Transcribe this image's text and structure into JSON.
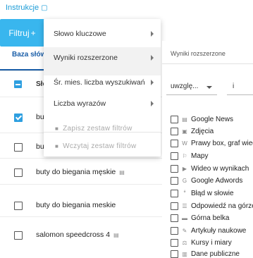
{
  "header": {
    "instructions": "Instrukcje",
    "filter_button": "Filtruj",
    "filter_plus": "+"
  },
  "tabs": [
    {
      "label": "Baza słów kl"
    }
  ],
  "table": {
    "column": "Słow",
    "rows": [
      {
        "keyword": "buty",
        "checked": true,
        "doc_icon": false
      },
      {
        "keyword": "buty",
        "checked": false,
        "doc_icon": false
      },
      {
        "keyword": "buty do biegania męskie",
        "checked": false,
        "doc_icon": true
      },
      {
        "keyword": "buty do biegania meskie",
        "checked": false,
        "doc_icon": false
      },
      {
        "keyword": "salomon speedcross 4",
        "checked": false,
        "doc_icon": true
      }
    ]
  },
  "menu": {
    "items": [
      {
        "label": "Słowo kluczowe",
        "submenu": true
      },
      {
        "label": "Wyniki rozszerzone",
        "submenu": true,
        "highlighted": true
      },
      {
        "label": "Śr. mies. liczba wyszukiwań",
        "submenu": true
      },
      {
        "label": "Liczba wyrazów",
        "submenu": true
      }
    ],
    "disabled_items": [
      {
        "label": "Zapisz zestaw filtrów",
        "icon": "floppy-icon"
      },
      {
        "label": "Wczytaj zestaw filtrów",
        "icon": "floppy-icon"
      }
    ]
  },
  "panel": {
    "title": "Wyniki rozszerzone",
    "select_value": "uwzglę...",
    "input_value": "i",
    "features": [
      {
        "label": "Google News",
        "icon": "news-icon",
        "glyph": "▤"
      },
      {
        "label": "Zdjęcia",
        "icon": "image-icon",
        "glyph": "▣"
      },
      {
        "label": "Prawy box, graf wiedzy",
        "icon": "box-icon",
        "glyph": "W"
      },
      {
        "label": "Mapy",
        "icon": "map-icon",
        "glyph": "⚐"
      },
      {
        "label": "Wideo w wynikach",
        "icon": "video-icon",
        "glyph": "▶"
      },
      {
        "label": "Google Adwords",
        "icon": "google-icon",
        "glyph": "G"
      },
      {
        "label": "Błąd w słowie",
        "icon": "typo-icon",
        "glyph": "ꜜ"
      },
      {
        "label": "Odpowiedź na górze",
        "icon": "answer-icon",
        "glyph": "☰"
      },
      {
        "label": "Górna belka",
        "icon": "bar-icon",
        "glyph": "▬"
      },
      {
        "label": "Artykuły naukowe",
        "icon": "science-icon",
        "glyph": "✎"
      },
      {
        "label": "Kursy i miary",
        "icon": "measure-icon",
        "glyph": "⚖"
      },
      {
        "label": "Dane publiczne",
        "icon": "data-icon",
        "glyph": "▥"
      }
    ]
  }
}
